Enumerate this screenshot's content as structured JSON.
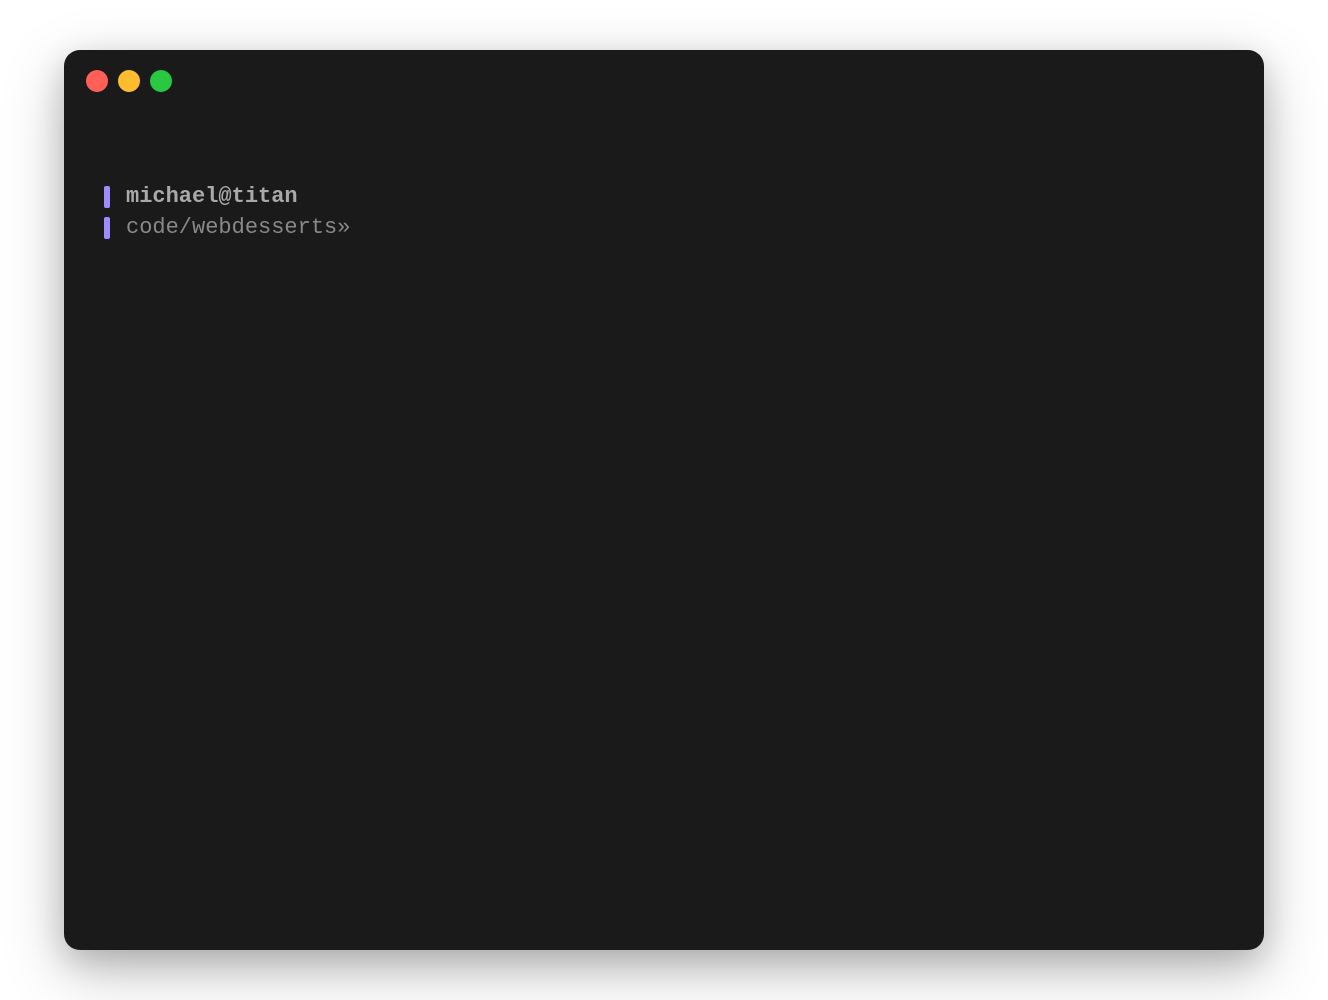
{
  "terminal": {
    "prompt": {
      "user_host": "michael@titan",
      "path": "code/webdesserts»"
    },
    "colors": {
      "background": "#1a1a1a",
      "marker": "#9d8cfc",
      "user_host_text": "#a9a9a9",
      "path_text": "#888888",
      "close_button": "#ff5f57",
      "minimize_button": "#febc2e",
      "maximize_button": "#28c840"
    }
  }
}
